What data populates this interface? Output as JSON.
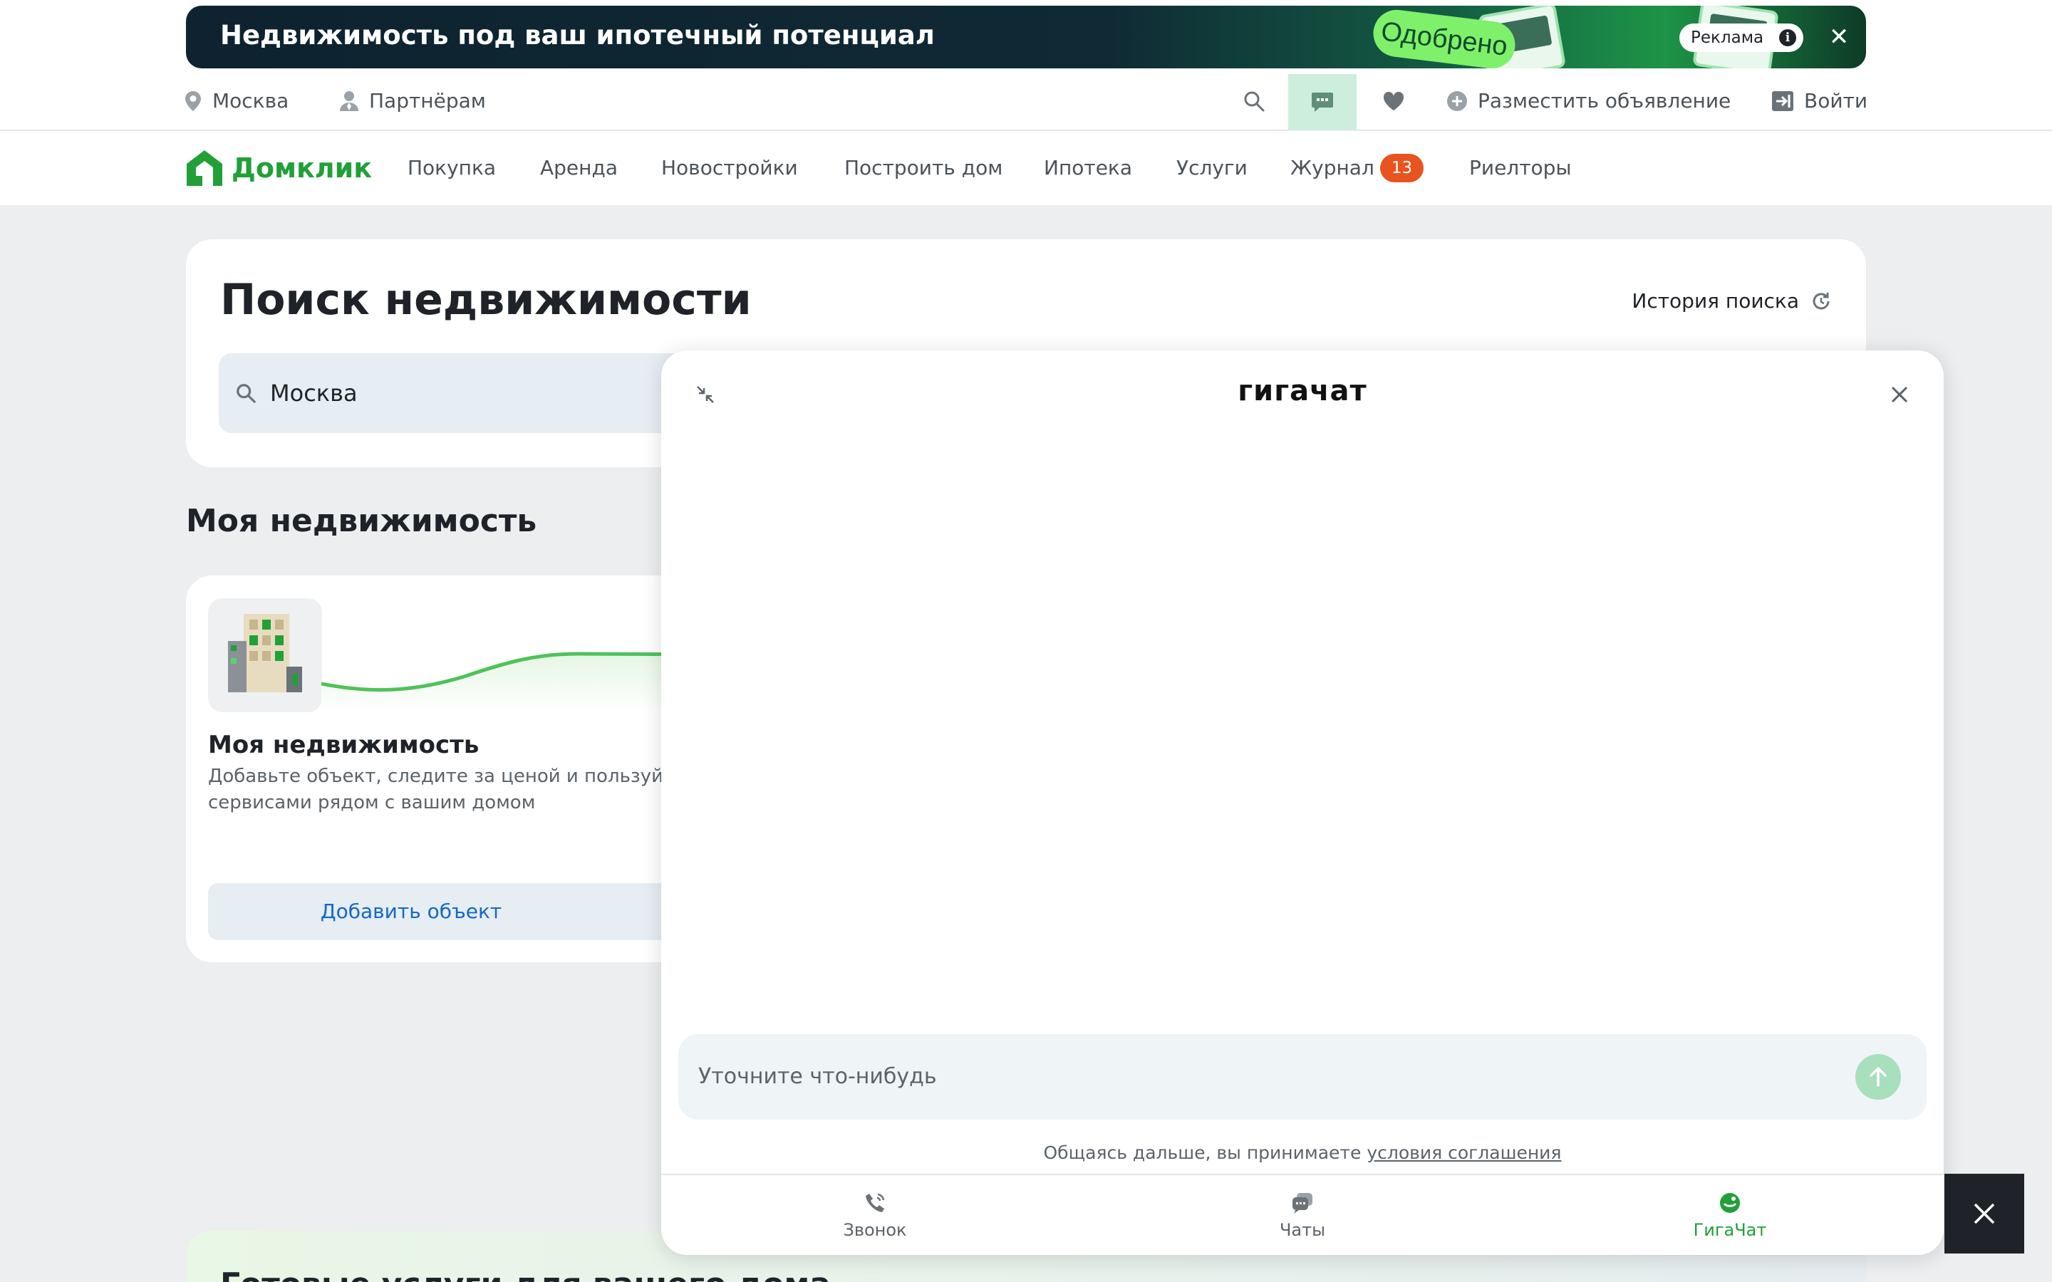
{
  "ad": {
    "title": "Недвижимость под ваш ипотечный потенциал",
    "badge_text": "Одобрено",
    "label": "Реклама",
    "info": "i"
  },
  "util": {
    "city": "Москва",
    "partners": "Партнёрам",
    "post_ad": "Разместить объявление",
    "login": "Войти"
  },
  "nav": {
    "logo": "Домклик",
    "items": [
      "Покупка",
      "Аренда",
      "Новостройки",
      "Построить дом",
      "Ипотека",
      "Услуги",
      "Журнал",
      "Риелторы"
    ],
    "journal_badge": "13"
  },
  "search": {
    "title": "Поиск недвижимости",
    "history": "История поиска",
    "value": "Москва"
  },
  "my_property": {
    "heading": "Моя недвижимость",
    "card_title": "Моя недвижимость",
    "card_desc": "Добавьте объект, следите за ценой и пользуйт сервисами рядом с вашим домом",
    "add_button": "Добавить объект"
  },
  "promo": {
    "title": "Готовые услуги для вашего дома"
  },
  "gigachat": {
    "logo": "гигачат",
    "input_placeholder": "Уточните что-нибудь",
    "terms_prefix": "Общаясь дальше, вы принимаете",
    "terms_link": "условия соглашения",
    "tabs": [
      "Звонок",
      "Чаты",
      "ГигаЧат"
    ]
  },
  "colors": {
    "brand_green": "#21a038",
    "badge_orange": "#e8531f",
    "link_blue": "#1668c7"
  }
}
